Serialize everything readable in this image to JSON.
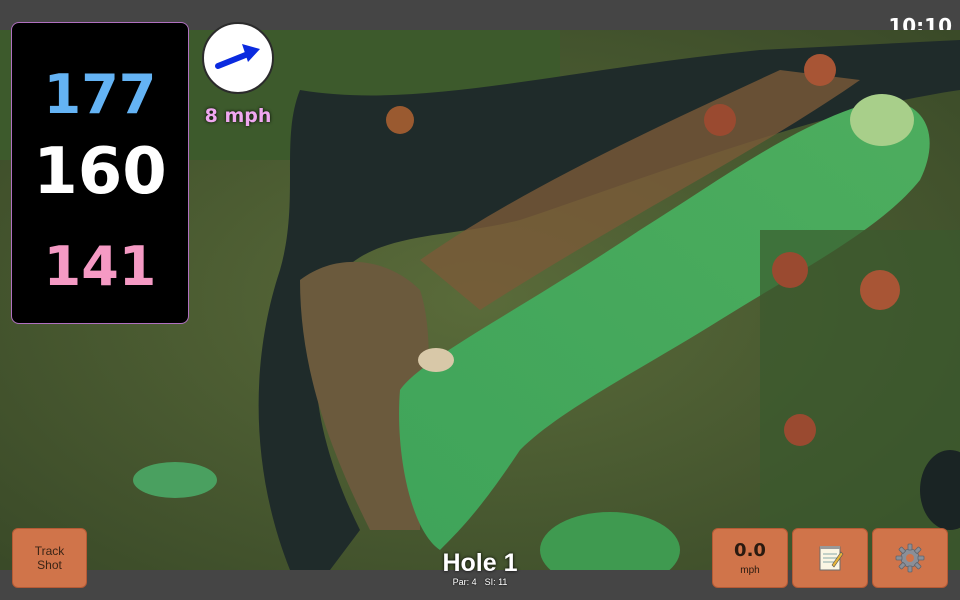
{
  "status": {
    "clock": "10:10"
  },
  "distances": {
    "back": "177",
    "middle": "160",
    "front": "141"
  },
  "wind": {
    "speed_label": "8 mph",
    "direction_icon": "arrow-right-icon"
  },
  "buttons": {
    "track_shot": "Track\nShot",
    "wind_value": "0.0",
    "wind_unit": "mph",
    "notes_icon": "notepad-icon",
    "settings_icon": "gear-icon"
  },
  "hole": {
    "title": "Hole 1",
    "par": "Par: 4",
    "stroke_index": "SI: 11"
  },
  "colors": {
    "back_distance": "#64b3f4",
    "middle_distance": "#ffffff",
    "front_distance": "#f59ac4",
    "button": "#d0744a",
    "wind_text": "#f0a8f0"
  }
}
